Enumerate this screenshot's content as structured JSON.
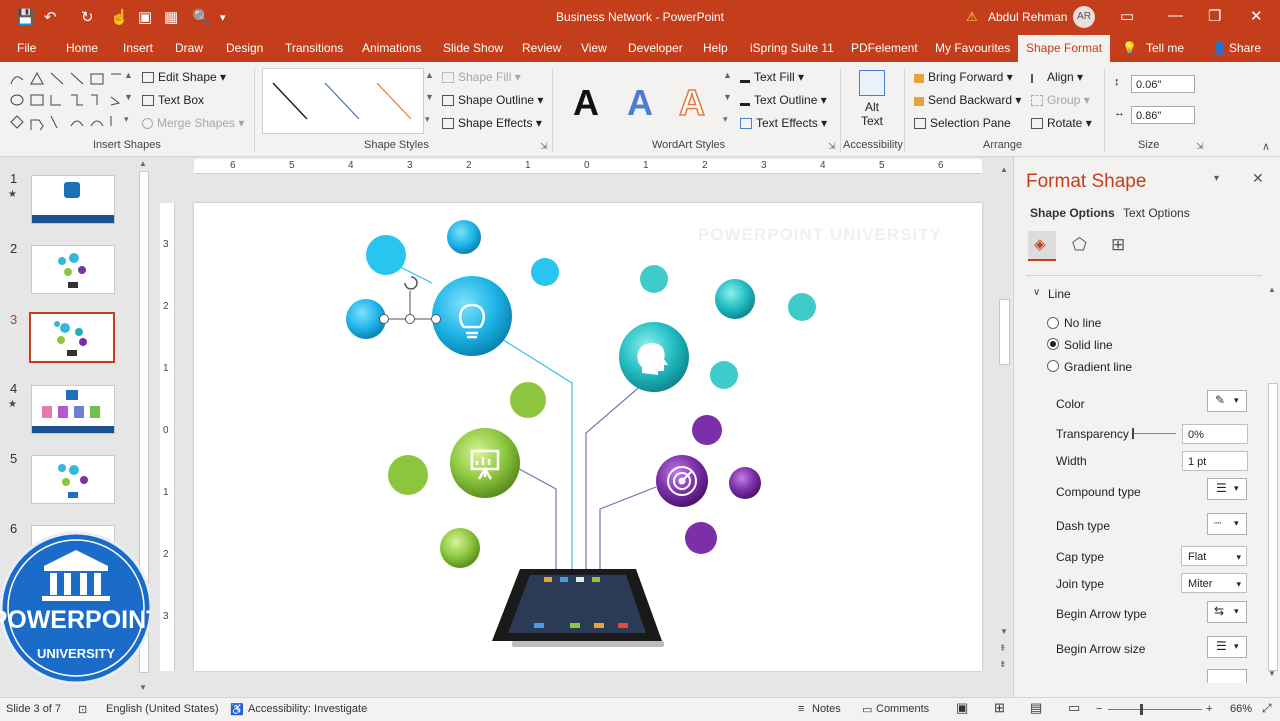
{
  "app": {
    "title": "Business Network - PowerPoint",
    "user": "Abdul Rehman",
    "initials": "AR",
    "accent": "#c43e1c"
  },
  "tabs": [
    "File",
    "Home",
    "Insert",
    "Draw",
    "Design",
    "Transitions",
    "Animations",
    "Slide Show",
    "Review",
    "View",
    "Developer",
    "Help",
    "iSpring Suite 11",
    "PDFelement",
    "My Favourites",
    "Shape Format",
    "Tell me",
    "Share"
  ],
  "ribbon": {
    "insert_shapes": {
      "edit_shape": "Edit Shape",
      "text_box": "Text Box",
      "merge_shapes": "Merge Shapes",
      "label": "Insert Shapes"
    },
    "shape_styles": {
      "fill": "Shape Fill",
      "outline": "Shape Outline",
      "effects": "Shape Effects",
      "label": "Shape Styles"
    },
    "wordart": {
      "letter": "A",
      "text_fill": "Text Fill",
      "text_outline": "Text Outline",
      "text_effects": "Text Effects",
      "label": "WordArt Styles"
    },
    "accessibility": {
      "alt_text_1": "Alt",
      "alt_text_2": "Text",
      "label": "Accessibility"
    },
    "arrange": {
      "bring_forward": "Bring Forward",
      "send_backward": "Send Backward",
      "selection_pane": "Selection Pane",
      "align": "Align",
      "group": "Group",
      "rotate": "Rotate",
      "label": "Arrange"
    },
    "size": {
      "height": "0.06\"",
      "width": "0.86\"",
      "label": "Size"
    }
  },
  "ruler": {
    "labels": [
      "6",
      "5",
      "4",
      "3",
      "2",
      "1",
      "0",
      "1",
      "2",
      "3",
      "4",
      "5",
      "6"
    ],
    "vlabels": [
      "3",
      "2",
      "1",
      "0",
      "1",
      "2",
      "3"
    ]
  },
  "slides": [
    {
      "num": "1",
      "star": "★"
    },
    {
      "num": "2",
      "star": ""
    },
    {
      "num": "3",
      "star": ""
    },
    {
      "num": "4",
      "star": "★"
    },
    {
      "num": "5",
      "star": ""
    },
    {
      "num": "6",
      "star": ""
    }
  ],
  "slide": {
    "watermark": "POWERPOINT UNIVERSITY"
  },
  "logo": {
    "line1": "POWERPOINT",
    "line2": "UNIVERSITY"
  },
  "pane": {
    "title": "Format Shape",
    "tab_shape": "Shape Options",
    "tab_text": "Text Options",
    "section": "Line",
    "options": [
      "No line",
      "Solid line",
      "Gradient line"
    ],
    "color": "Color",
    "transparency": "Transparency",
    "transparency_value": "0%",
    "width": "Width",
    "width_value": "1 pt",
    "compound": "Compound type",
    "dash": "Dash type",
    "cap": "Cap type",
    "cap_value": "Flat",
    "join": "Join type",
    "join_value": "Miter",
    "begin_arrow_type": "Begin Arrow type",
    "begin_arrow_size": "Begin Arrow size"
  },
  "status": {
    "slide": "Slide 3 of 7",
    "language": "English (United States)",
    "accessibility": "Accessibility: Investigate",
    "notes": "Notes",
    "comments": "Comments",
    "zoom": "66%"
  }
}
